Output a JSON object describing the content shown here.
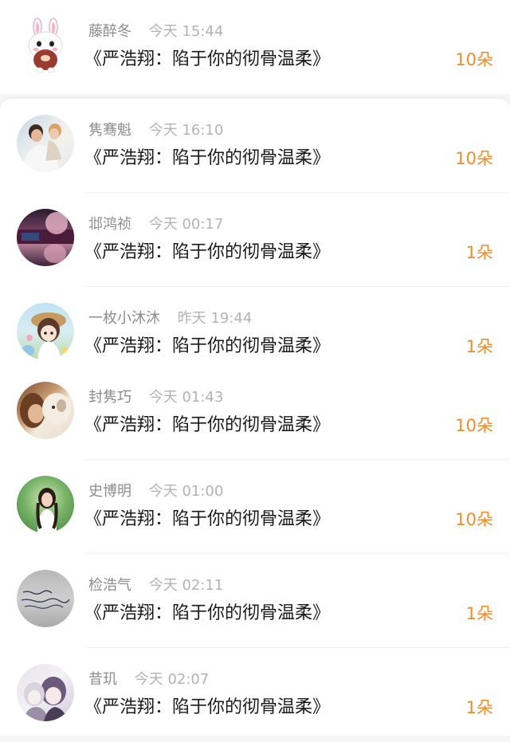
{
  "items": [
    {
      "name": "藤醉冬",
      "time": "今天 15:44",
      "title": "《严浩翔：陷于你的彻骨温柔》",
      "count": "10朵",
      "avatar": "rabbit-avatar"
    },
    {
      "name": "隽骞魁",
      "time": "今天 16:10",
      "title": "《严浩翔：陷于你的彻骨温柔》",
      "count": "10朵",
      "avatar": "couple-photo-avatar"
    },
    {
      "name": "邶鸿祯",
      "time": "今天 00:17",
      "title": "《严浩翔：陷于你的彻骨温柔》",
      "count": "1朵",
      "avatar": "dark-portrait-avatar"
    },
    {
      "name": "一枚小沐沐",
      "time": "昨天 19:44",
      "title": "《严浩翔：陷于你的彻骨温柔》",
      "count": "1朵",
      "avatar": "cartoon-girl-avatar"
    },
    {
      "name": "封隽巧",
      "time": "今天 01:43",
      "title": "《严浩翔：陷于你的彻骨温柔》",
      "count": "10朵",
      "avatar": "dog-photo-avatar"
    },
    {
      "name": "史博明",
      "time": "今天 01:00",
      "title": "《严浩翔：陷于你的彻骨温柔》",
      "count": "10朵",
      "avatar": "girl-photo-avatar"
    },
    {
      "name": "检浩气",
      "time": "今天 02:11",
      "title": "《严浩翔：陷于你的彻骨温柔》",
      "count": "1朵",
      "avatar": "handwriting-avatar"
    },
    {
      "name": "昔玑",
      "time": "今天 02:07",
      "title": "《严浩翔：陷于你的彻骨温柔》",
      "count": "1朵",
      "avatar": "anime-avatar"
    }
  ],
  "colors": {
    "accent": "#f08c2c",
    "name": "#8c8c8c",
    "time": "#b3b3b3",
    "title": "#1a1a1a",
    "background": "#f5f5f5"
  }
}
